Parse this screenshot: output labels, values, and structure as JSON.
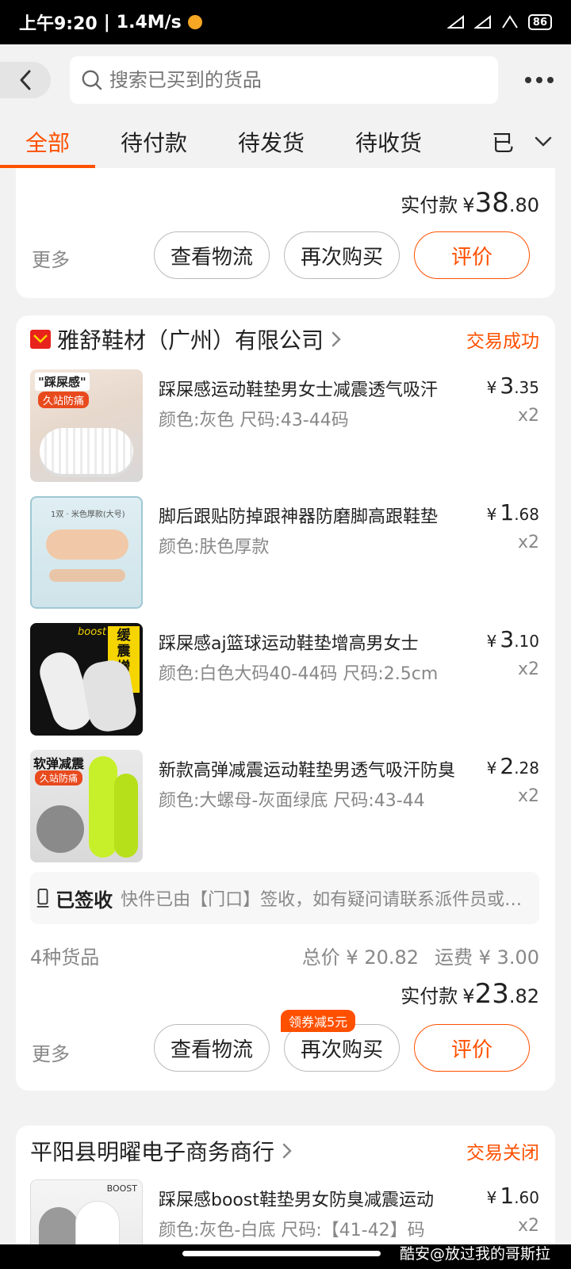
{
  "status_bar": {
    "time": "上午9:20",
    "speed": "1.4M/s",
    "battery": "86"
  },
  "search": {
    "placeholder": "搜索已买到的货品"
  },
  "tabs": [
    "全部",
    "待付款",
    "待发货",
    "待收货"
  ],
  "tab_overflow": "已",
  "colors": {
    "accent": "#ff5000"
  },
  "orders": [
    {
      "pay_label": "实付款",
      "pay_yen": "¥",
      "pay_int": "38",
      "pay_dec": ".80",
      "more": "更多",
      "btn_logistics": "查看物流",
      "btn_rebuy": "再次购买",
      "btn_review": "评价"
    },
    {
      "shop": "雅舒鞋材（广州）有限公司",
      "status": "交易成功",
      "items": [
        {
          "title": "踩屎感运动鞋垫男女士减震透气吸汗",
          "spec": "颜色:灰色 尺码:43-44码",
          "price_int": "3",
          "price_dec": ".35",
          "qty": "x2",
          "thumb_text_a": "\"踩屎感\"",
          "thumb_text_b": "久站防痛"
        },
        {
          "title": "脚后跟贴防掉跟神器防磨脚高跟鞋垫",
          "spec": "颜色:肤色厚款",
          "price_int": "1",
          "price_dec": ".68",
          "qty": "x2",
          "thumb_text_a": "1双 · 米色厚款(大号)"
        },
        {
          "title": "踩屎感aj篮球运动鞋垫增高男女士",
          "spec": "颜色:白色大码40-44码 尺码:2.5cm",
          "price_int": "3",
          "price_dec": ".10",
          "qty": "x2",
          "thumb_text_a": "缓震",
          "thumb_text_b": "增高",
          "thumb_text_c": "boost"
        },
        {
          "title": "新款高弹减震运动鞋垫男透气吸汗防臭",
          "spec": "颜色:大螺母-灰面绿底 尺码:43-44",
          "price_int": "2",
          "price_dec": ".28",
          "qty": "x2",
          "thumb_text_a": "软弹减震",
          "thumb_text_b": "久站防痛"
        }
      ],
      "logistics_status": "已签收",
      "logistics_text": "快件已由【门口】签收，如有疑问请联系派件员或查看详情",
      "count": "4种货品",
      "total": "总价 ¥ 20.82",
      "shipping": "运费 ¥ 3.00",
      "pay_label": "实付款",
      "pay_yen": "¥",
      "pay_int": "23",
      "pay_dec": ".82",
      "more": "更多",
      "btn_logistics": "查看物流",
      "btn_rebuy": "再次购买",
      "coupon": "领券减5元",
      "btn_review": "评价"
    },
    {
      "shop": "平阳县明曜电子商务商行",
      "status": "交易关闭",
      "items": [
        {
          "title": "踩屎感boost鞋垫男女防臭减震运动",
          "spec": "颜色:灰色-白底 尺码:【41-42】码",
          "price_int": "1",
          "price_dec": ".60",
          "qty": "x2",
          "thumb_text_a": "BOOST"
        }
      ]
    }
  ],
  "watermark": "酷安@放过我的哥斯拉"
}
